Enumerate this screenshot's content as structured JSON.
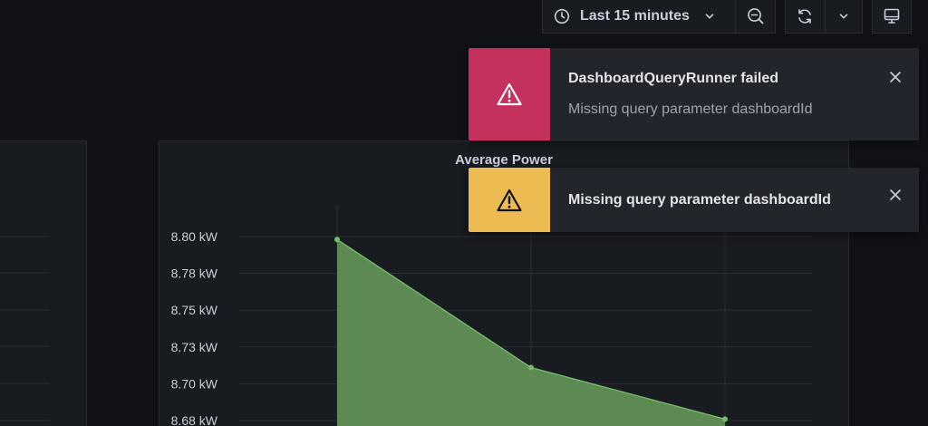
{
  "toolbar": {
    "time_range_label": "Last 15 minutes"
  },
  "panel": {
    "title": "Average Power"
  },
  "toasts": [
    {
      "type": "error",
      "title": "DashboardQueryRunner failed",
      "description": "Missing query parameter dashboardId"
    },
    {
      "type": "warning",
      "title": "Missing query parameter dashboardId"
    }
  ],
  "colors": {
    "background": "#111217",
    "panel": "#181b1f",
    "error": "#c4315d",
    "warning": "#ecbb52",
    "series_line": "#73bf69",
    "series_fill": "#5d8a52"
  },
  "icons": {
    "time": "clock-icon",
    "zoom": "zoom-out-icon",
    "refresh": "refresh-icon",
    "refresh_menu": "chevron-down-icon",
    "tv": "monitor-icon",
    "alert": "exclamation-triangle-icon",
    "close": "close-icon"
  },
  "chart_data": {
    "type": "area",
    "title": "Average Power",
    "xlabel": "",
    "ylabel": "",
    "ylim": [
      8.655,
      8.81
    ],
    "y_ticks": [
      "8.80 kW",
      "8.78 kW",
      "8.75 kW",
      "8.73 kW",
      "8.70 kW",
      "8.68 kW"
    ],
    "y_tick_values": [
      8.8,
      8.775,
      8.75,
      8.725,
      8.7,
      8.675
    ],
    "series": [
      {
        "values": [
          8.798,
          8.711,
          8.676
        ]
      }
    ]
  }
}
